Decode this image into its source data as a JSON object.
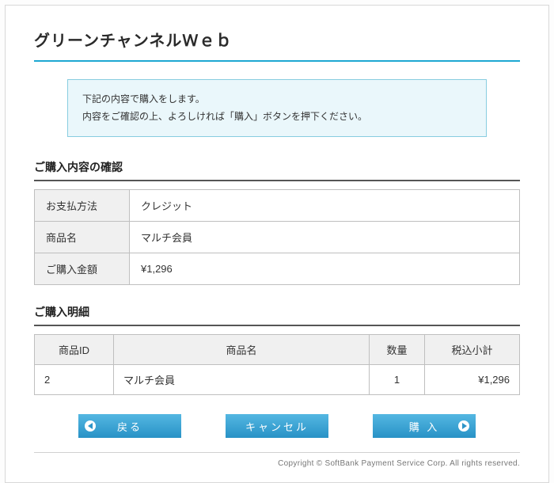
{
  "title": "グリーンチャンネルＷｅｂ",
  "message": {
    "line1": "下記の内容で購入をします。",
    "line2": "内容をご確認の上、よろしければ「購入」ボタンを押下ください。"
  },
  "confirm": {
    "heading": "ご購入内容の確認",
    "rows": {
      "payment_label": "お支払方法",
      "payment_value": "クレジット",
      "product_label": "商品名",
      "product_value": "マルチ会員",
      "amount_label": "ご購入金額",
      "amount_value": "¥1,296"
    }
  },
  "detail": {
    "heading": "ご購入明細",
    "headers": {
      "id": "商品ID",
      "name": "商品名",
      "qty": "数量",
      "subtotal": "税込小計"
    },
    "row": {
      "id": "2",
      "name": "マルチ会員",
      "qty": "1",
      "subtotal": "¥1,296"
    }
  },
  "buttons": {
    "back": "戻る",
    "cancel": "キャンセル",
    "purchase": "購 入"
  },
  "footer": "Copyright © SoftBank Payment Service Corp. All rights reserved."
}
